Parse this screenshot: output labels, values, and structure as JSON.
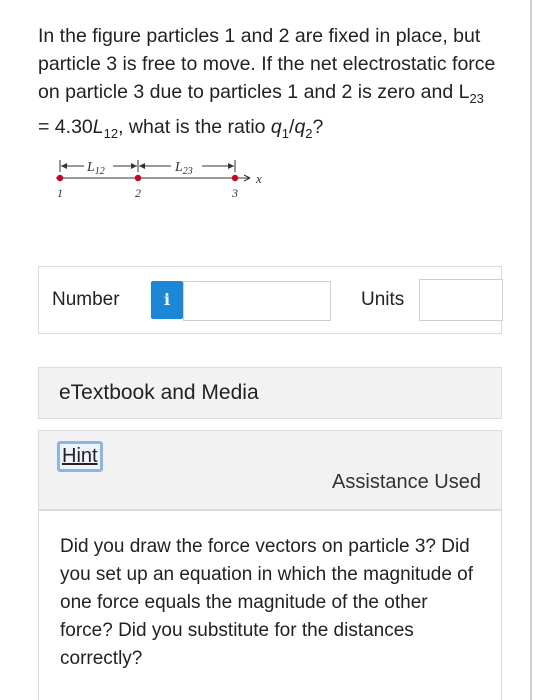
{
  "question": {
    "part1": "In the figure particles 1 and 2 are fixed in place, but particle 3 is free to move. If the net electrostatic force on particle 3 due to particles 1 and 2 is zero and ",
    "L": "L",
    "sub23": "23",
    "eq": " = 4.30",
    "sub12": "12",
    "part2": ", what is the ratio ",
    "q": "q",
    "sub1": "1",
    "slash": "/",
    "sub2": "2",
    "end": "?"
  },
  "figure": {
    "L12_label": "L",
    "L12_sub": "12",
    "L23_label": "L",
    "L23_sub": "23",
    "x_label": "x",
    "p1": "1",
    "p2": "2",
    "p3": "3",
    "particle_color": "#d0021b"
  },
  "answer": {
    "number_label": "Number",
    "info_icon": "i",
    "units_label": "Units"
  },
  "etextbook": {
    "label": "eTextbook and Media"
  },
  "hint": {
    "link": "Hint",
    "assistance": "Assistance Used",
    "text": "Did you draw the force vectors on particle 3? Did you set up an equation in which the magnitude of one force equals the magnitude of the other force? Did you substitute for the distances correctly?"
  }
}
